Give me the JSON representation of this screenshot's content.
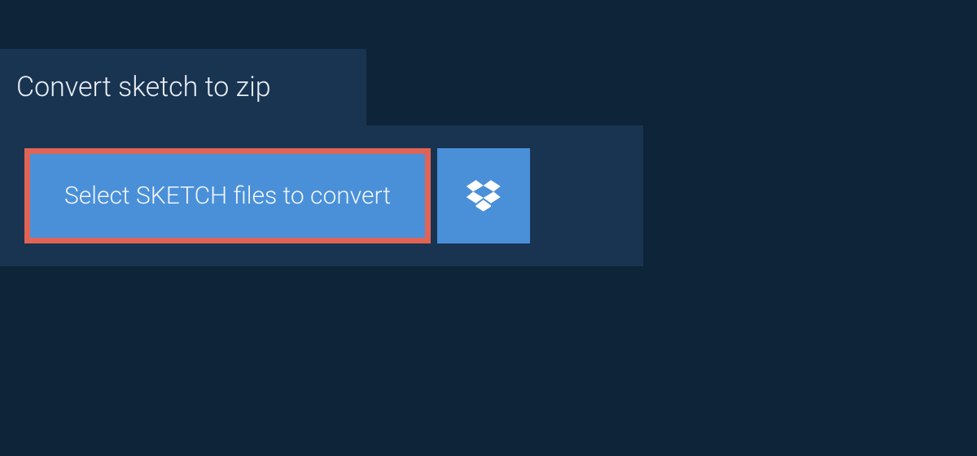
{
  "tab": {
    "title": "Convert sketch to zip"
  },
  "panel": {
    "select_button_label": "Select SKETCH files to convert"
  }
}
